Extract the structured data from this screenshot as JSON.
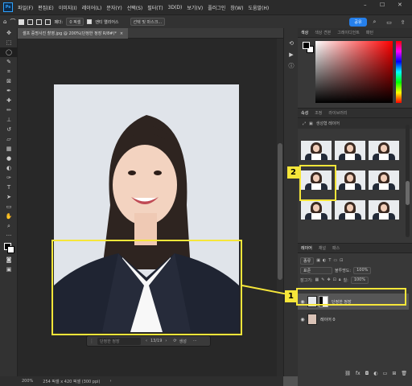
{
  "app": {
    "logo": "Ps"
  },
  "menu": [
    "파일(F)",
    "편집(E)",
    "이미지(I)",
    "레이어(L)",
    "문자(Y)",
    "선택(S)",
    "필터(T)",
    "3D(D)",
    "보기(V)",
    "플러그인",
    "창(W)",
    "도움말(H)"
  ],
  "window_controls": {
    "minimize": "–",
    "maximize": "☐",
    "close": "✕"
  },
  "options_bar": {
    "feather_label": "페더:",
    "feather_value": "0 픽셀",
    "antialias_label": "앤티 앨리어스",
    "select_mask_button": "선택 및 마스크...",
    "share_button": "공유"
  },
  "document_tab": {
    "title": "셀프 증명사진 촬영.jpg @ 200%(단정한 정장 R/8#)*",
    "close": "×"
  },
  "status_bar": {
    "zoom": "200%",
    "doc_info": "254 픽셀 x 420 픽셀 (300 ppi)",
    "arrow": "›"
  },
  "context_bar": {
    "prompt_placeholder": "단정한 정장",
    "page": "13/19",
    "generate_label": "생성",
    "more": "···"
  },
  "panels": {
    "color_tabs": [
      "색상",
      "색상 견본",
      "그레이디언트",
      "패턴"
    ],
    "library_tabs": [
      "속성",
      "조정",
      "라이브러리"
    ],
    "library_sub": "생성형 레이어",
    "layers_tabs": [
      "레이어",
      "채널",
      "패스"
    ],
    "layers_filter": "종류",
    "blend_mode": "표준",
    "opacity_label": "불투명도:",
    "opacity_value": "100%",
    "lock_label": "잠그기:",
    "fill_label": "칠:",
    "fill_value": "100%",
    "layers": [
      {
        "name": "단정한 정장",
        "selected": true
      },
      {
        "name": "레이어 0",
        "selected": false
      }
    ]
  },
  "annotations": {
    "badge1": "1",
    "badge2": "2",
    "color": "#f6e63a"
  },
  "tool_icons": [
    "move-icon",
    "marquee-icon",
    "lasso-icon",
    "quick-select-icon",
    "crop-icon",
    "frame-icon",
    "eyedropper-icon",
    "spot-heal-icon",
    "brush-icon",
    "clone-stamp-icon",
    "history-brush-icon",
    "eraser-icon",
    "gradient-icon",
    "blur-icon",
    "dodge-icon",
    "pen-icon",
    "type-icon",
    "path-select-icon",
    "shape-icon",
    "hand-icon",
    "zoom-icon",
    "more-icon"
  ]
}
